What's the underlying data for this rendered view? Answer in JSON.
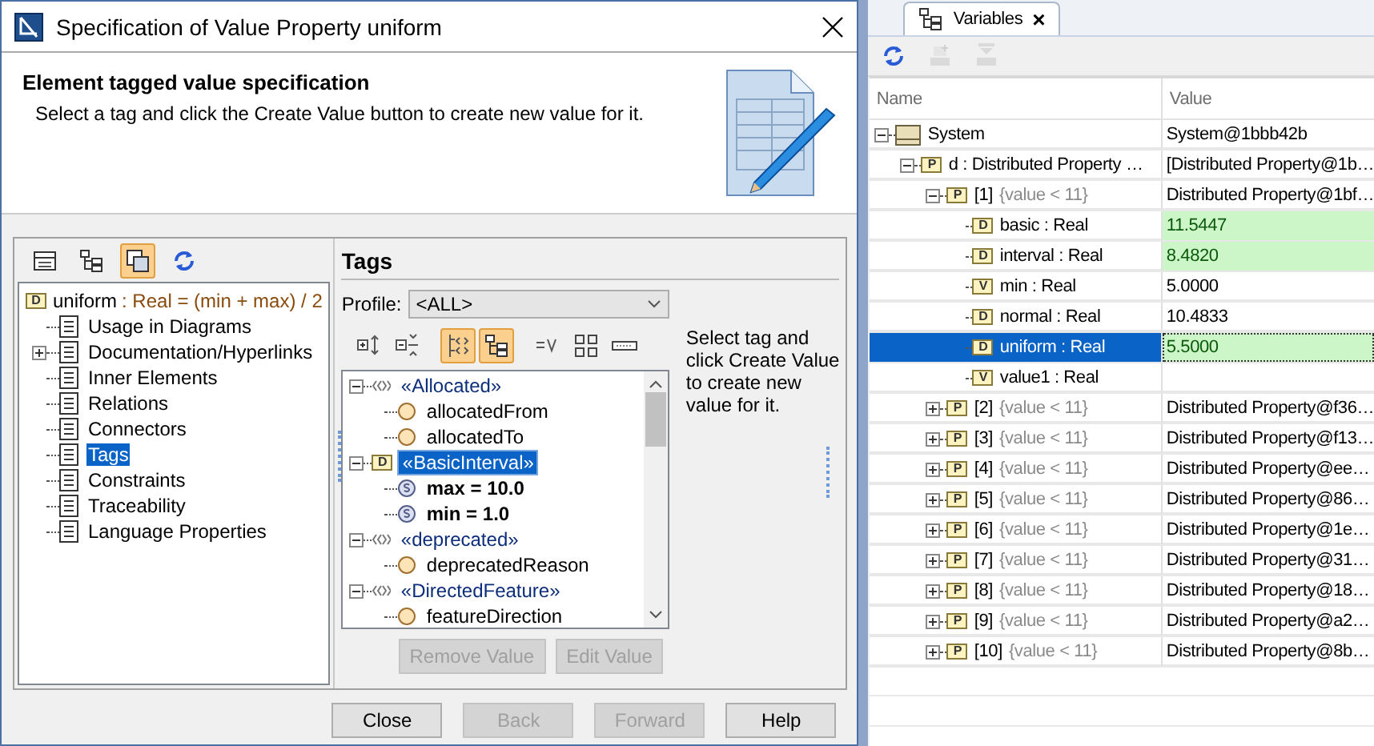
{
  "window": {
    "title": "Specification of Value Property uniform"
  },
  "header": {
    "title": "Element tagged value specification",
    "description": "Select a tag and click the Create Value button to create new value for it."
  },
  "nav_toolbar": [
    {
      "kind": "table",
      "pressed": false
    },
    {
      "kind": "tree",
      "pressed": false
    },
    {
      "kind": "copy",
      "pressed": true
    },
    {
      "kind": "refresh",
      "pressed": false
    }
  ],
  "nav_tree": {
    "root": {
      "badge": "D",
      "name": "uniform",
      "expression": ": Real = (min + max) / 2"
    },
    "items": [
      {
        "label": "Usage in Diagrams",
        "collapsed": false,
        "selected": false
      },
      {
        "label": "Documentation/Hyperlinks",
        "collapsed": true,
        "selected": false
      },
      {
        "label": "Inner Elements",
        "collapsed": false,
        "selected": false
      },
      {
        "label": "Relations",
        "collapsed": false,
        "selected": false
      },
      {
        "label": "Connectors",
        "collapsed": false,
        "selected": false
      },
      {
        "label": "Tags",
        "collapsed": false,
        "selected": true
      },
      {
        "label": "Constraints",
        "collapsed": false,
        "selected": false
      },
      {
        "label": "Traceability",
        "collapsed": false,
        "selected": false
      },
      {
        "label": "Language Properties",
        "collapsed": false,
        "selected": false
      }
    ]
  },
  "tags": {
    "title": "Tags",
    "profile_label": "Profile:",
    "profile": "<ALL>",
    "toolbar": [
      {
        "kind": "expand",
        "pressed": false
      },
      {
        "kind": "collapse",
        "pressed": false
      },
      {
        "kind": "stereotypes",
        "pressed": true
      },
      {
        "kind": "tree",
        "pressed": true
      },
      {
        "kind": "value",
        "pressed": false
      },
      {
        "kind": "grid",
        "pressed": false
      },
      {
        "kind": "field",
        "pressed": false
      }
    ],
    "tree": [
      {
        "label": "«Allocated»",
        "kind": "stereotype",
        "expanded": true,
        "selected": false,
        "children": [
          {
            "label": "allocatedFrom",
            "kind": "tag"
          },
          {
            "label": "allocatedTo",
            "kind": "tag"
          }
        ]
      },
      {
        "label": "«BasicInterval»",
        "kind": "datatype",
        "badge": "D",
        "expanded": true,
        "selected": true,
        "children": [
          {
            "label": "max = 10.0",
            "kind": "slot"
          },
          {
            "label": "min = 1.0",
            "kind": "slot"
          }
        ]
      },
      {
        "label": "«deprecated»",
        "kind": "stereotype",
        "expanded": true,
        "selected": false,
        "children": [
          {
            "label": "deprecatedReason",
            "kind": "tag"
          }
        ]
      },
      {
        "label": "«DirectedFeature»",
        "kind": "stereotype",
        "expanded": true,
        "selected": false,
        "children": [
          {
            "label": "featureDirection",
            "kind": "tag"
          }
        ]
      }
    ],
    "hint": "Select tag and click Create Value to create new value for it.",
    "buttons": [
      {
        "label": "Remove Value",
        "disabled": true
      },
      {
        "label": "Edit Value",
        "disabled": true
      }
    ]
  },
  "footer_buttons": [
    {
      "label": "Close",
      "disabled": false
    },
    {
      "label": "Back",
      "disabled": true
    },
    {
      "label": "Forward",
      "disabled": true
    },
    {
      "label": "Help",
      "disabled": false
    }
  ],
  "variables": {
    "tab": {
      "label": "Variables",
      "close": "×"
    },
    "toolbar": [
      {
        "kind": "refresh",
        "disabled": false
      },
      {
        "kind": "tray-add",
        "disabled": true
      },
      {
        "kind": "tray",
        "disabled": true
      }
    ],
    "columns": [
      "Name",
      "Value"
    ],
    "rows": [
      {
        "kind": "system",
        "name": "System",
        "value": "System@1bbb42b",
        "expanded": true,
        "selected": false,
        "changed": false,
        "children": [
          {
            "badge": "P",
            "name": "d : Distributed Property …",
            "value": "[Distributed Property@1b…",
            "expanded": true,
            "selected": false,
            "changed": false,
            "children": [
              {
                "badge": "P",
                "name": "[1]",
                "constraint": "{value < 11}",
                "value": "Distributed Property@1bf…",
                "expanded": true,
                "selected": false,
                "changed": false,
                "children": [
                  {
                    "badge": "D",
                    "name": "basic : Real",
                    "value": "11.5447",
                    "selected": false,
                    "changed": true
                  },
                  {
                    "badge": "D",
                    "name": "interval : Real",
                    "value": "8.4820",
                    "selected": false,
                    "changed": true
                  },
                  {
                    "badge": "V",
                    "name": "min : Real",
                    "value": "5.0000",
                    "selected": false,
                    "changed": false
                  },
                  {
                    "badge": "D",
                    "name": "normal : Real",
                    "value": "10.4833",
                    "selected": false,
                    "changed": false
                  },
                  {
                    "badge": "D",
                    "name": "uniform : Real",
                    "value": "5.5000",
                    "selected": true,
                    "changed": true
                  },
                  {
                    "badge": "V",
                    "name": "value1 : Real",
                    "selected": false,
                    "changed": false
                  }
                ]
              },
              {
                "badge": "P",
                "name": "[2]",
                "constraint": "{value < 11}",
                "value": "Distributed Property@f36…",
                "expanded": false,
                "selected": false,
                "changed": false
              },
              {
                "badge": "P",
                "name": "[3]",
                "constraint": "{value < 11}",
                "value": "Distributed Property@f13…",
                "expanded": false,
                "selected": false,
                "changed": false
              },
              {
                "badge": "P",
                "name": "[4]",
                "constraint": "{value < 11}",
                "value": "Distributed Property@ee…",
                "expanded": false,
                "selected": false,
                "changed": false
              },
              {
                "badge": "P",
                "name": "[5]",
                "constraint": "{value < 11}",
                "value": "Distributed Property@86…",
                "expanded": false,
                "selected": false,
                "changed": false
              },
              {
                "badge": "P",
                "name": "[6]",
                "constraint": "{value < 11}",
                "value": "Distributed Property@1e…",
                "expanded": false,
                "selected": false,
                "changed": false
              },
              {
                "badge": "P",
                "name": "[7]",
                "constraint": "{value < 11}",
                "value": "Distributed Property@31…",
                "expanded": false,
                "selected": false,
                "changed": false
              },
              {
                "badge": "P",
                "name": "[8]",
                "constraint": "{value < 11}",
                "value": "Distributed Property@18…",
                "expanded": false,
                "selected": false,
                "changed": false
              },
              {
                "badge": "P",
                "name": "[9]",
                "constraint": "{value < 11}",
                "value": "Distributed Property@a2…",
                "expanded": false,
                "selected": false,
                "changed": false
              },
              {
                "badge": "P",
                "name": "[10]",
                "constraint": "{value < 11}",
                "value": "Distributed Property@8b…",
                "expanded": false,
                "selected": false,
                "changed": false
              }
            ]
          }
        ]
      }
    ]
  }
}
